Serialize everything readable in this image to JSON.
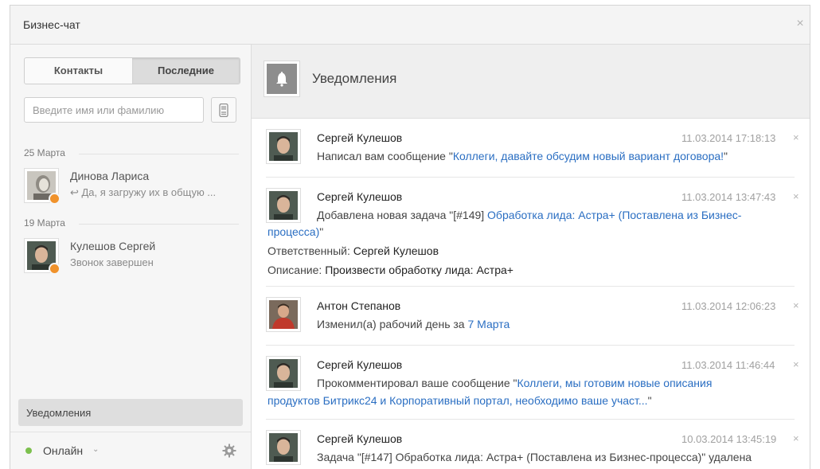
{
  "window": {
    "title": "Бизнес-чат",
    "close_glyph": "×"
  },
  "left": {
    "tabs": [
      {
        "label": "Контакты"
      },
      {
        "label": "Последние"
      }
    ],
    "search": {
      "placeholder": "Введите имя или фамилию",
      "value": ""
    },
    "groups": [
      {
        "date": "25 Марта",
        "contact": {
          "name": "Динова Лариса",
          "sub": "↩ Да, я загружу их в общую ..."
        }
      },
      {
        "date": "19 Марта",
        "contact": {
          "name": "Кулешов Сергей",
          "sub": "Звонок завершен"
        }
      }
    ],
    "notifications_label": "Уведомления",
    "status": {
      "label": "Онлайн",
      "caret": "⌄",
      "color": "#7cc04d"
    }
  },
  "right": {
    "title": "Уведомления",
    "items": [
      {
        "author": "Сергей Кулешов",
        "date": "11.03.2014 17:18:13",
        "l1_pre": "Написал вам сообщение \"",
        "l1_link": "Коллеги, давайте обсудим новый вариант договора!",
        "l1_post": "\""
      },
      {
        "author": "Сергей Кулешов",
        "date": "11.03.2014 13:47:43",
        "l1_pre": "Добавлена новая задача \"[#149] ",
        "l1_link": "Обработка лида: Астра+ (Поставлена из Бизнес-",
        "l2_link": "процесса)",
        "l2_post": "\"",
        "l3_label": "Ответственный: ",
        "l3_value": "Сергей Кулешов",
        "l4_label": "Описание: ",
        "l4_value": "Произвести обработку лида: Астра+"
      },
      {
        "author": "Антон Степанов",
        "date": "11.03.2014 12:06:23",
        "l1_pre": "Изменил(а) рабочий день за ",
        "l1_link": "7 Марта"
      },
      {
        "author": "Сергей Кулешов",
        "date": "11.03.2014 11:46:44",
        "l1_pre": "Прокомментировал ваше сообщение \"",
        "l1_link": "Коллеги, мы готовим новые описания",
        "l2_link": "продуктов Битрикс24 и Корпоративный портал, необходимо ваше участ...",
        "l2_post": "\""
      },
      {
        "author": "Сергей Кулешов",
        "date": "10.03.2014 13:45:19",
        "l1_pre": "Задача \"[#147] Обработка лида: Астра+ (Поставлена из Бизнес-процесса)\" удалена"
      }
    ],
    "dismiss_glyph": "×"
  },
  "colors": {
    "link": "#2a6ec2",
    "online": "#7cc04d",
    "presence": "#f0922b"
  }
}
